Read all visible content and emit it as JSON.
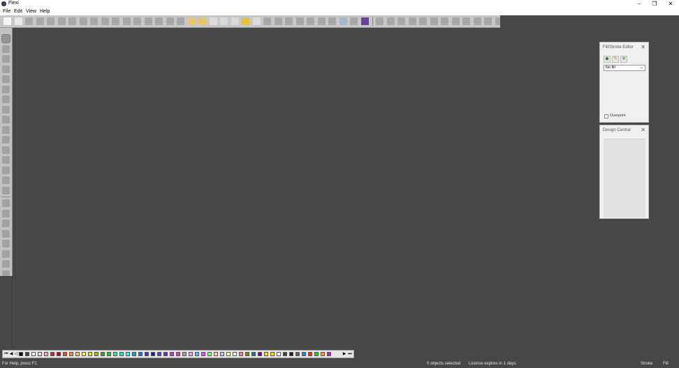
{
  "window": {
    "title": "Flexi",
    "controls": {
      "minimize": "–",
      "restore": "❐",
      "close": "✕"
    }
  },
  "menu": [
    {
      "label": "File"
    },
    {
      "label": "Edit"
    },
    {
      "label": "View"
    },
    {
      "label": "Help"
    }
  ],
  "toolbar": {
    "buttons": [
      {
        "icon": "new-icon",
        "color": "#f4f4f4"
      },
      {
        "icon": "open-icon",
        "color": "#e9e9e9"
      },
      {
        "icon": "save-icon",
        "color": "#a8a8a8"
      },
      {
        "icon": "save-as-icon",
        "color": "#a8a8a8"
      },
      {
        "icon": "print-icon",
        "color": "#a8a8a8"
      },
      {
        "icon": "import-icon",
        "color": "#a8a8a8"
      },
      {
        "icon": "export-icon",
        "color": "#a8a8a8"
      },
      {
        "icon": "send-icon",
        "color": "#a8a8a8"
      },
      {
        "icon": "cut-tool-icon",
        "color": "#a8a8a8"
      },
      {
        "icon": "rip-icon",
        "color": "#a8a8a8"
      },
      {
        "icon": "cut-icon",
        "color": "#a8a8a8"
      },
      {
        "icon": "copy-icon",
        "color": "#a8a8a8"
      },
      {
        "icon": "paste-icon",
        "color": "#a8a8a8"
      },
      {
        "icon": "undo-icon",
        "color": "#a8a8a8"
      },
      {
        "icon": "undo-more-icon",
        "color": "#a8a8a8"
      },
      {
        "icon": "redo-icon",
        "color": "#a8a8a8"
      },
      {
        "icon": "redo-more-icon",
        "color": "#a8a8a8"
      },
      {
        "icon": "job-icon",
        "color": "#e8c46a"
      },
      {
        "icon": "job-properties-icon",
        "color": "#e8c46a"
      },
      {
        "icon": "printer-setup-icon",
        "color": "#dcdcdc"
      },
      {
        "icon": "color-wheel-icon",
        "color": "#d9d9d9"
      },
      {
        "icon": "color-target-icon",
        "color": "#d9d9d9"
      },
      {
        "icon": "color-palette-icon",
        "color": "#e2c23a"
      },
      {
        "icon": "production-icon",
        "color": "#dcdcdc"
      },
      {
        "icon": "view-icon",
        "color": "#a8a8a8"
      },
      {
        "icon": "view-2-icon",
        "color": "#a8a8a8"
      },
      {
        "icon": "view-3-icon",
        "color": "#a8a8a8"
      },
      {
        "icon": "view-4-icon",
        "color": "#a8a8a8"
      },
      {
        "icon": "view-5-icon",
        "color": "#a8a8a8"
      },
      {
        "icon": "view-6-icon",
        "color": "#a8a8a8"
      },
      {
        "icon": "view-7-icon",
        "color": "#a8a8a8"
      },
      {
        "icon": "cloud-icon",
        "color": "#a0b8d0"
      },
      {
        "icon": "sign-icon",
        "color": "#a8a8a8"
      },
      {
        "icon": "app-logo-icon",
        "color": "#6a3fa0"
      },
      {
        "icon": "select-rect-icon",
        "color": "#a8a8a8"
      },
      {
        "icon": "lasso-icon",
        "color": "#a8a8a8"
      },
      {
        "icon": "line-tool-icon",
        "color": "#a8a8a8"
      },
      {
        "icon": "curve-icon",
        "color": "#a8a8a8"
      },
      {
        "icon": "knife-icon",
        "color": "#a8a8a8"
      },
      {
        "icon": "pen-icon",
        "color": "#a8a8a8"
      },
      {
        "icon": "pencil-icon",
        "color": "#a8a8a8"
      },
      {
        "icon": "brush-icon",
        "color": "#a8a8a8"
      },
      {
        "icon": "bucket-icon",
        "color": "#a8a8a8"
      },
      {
        "icon": "crop-icon",
        "color": "#a8a8a8"
      },
      {
        "icon": "stamp-icon",
        "color": "#a8a8a8"
      },
      {
        "icon": "eyedropper-icon",
        "color": "#a8a8a8"
      }
    ]
  },
  "left_tools": [
    {
      "icon": "select-arrow-icon"
    },
    {
      "icon": "text-tool-icon"
    },
    {
      "icon": "node-edit-icon"
    },
    {
      "icon": "shape-tool-icon"
    },
    {
      "icon": "warp-icon"
    },
    {
      "icon": "rectangle-tool-icon"
    },
    {
      "icon": "fill-tool-icon"
    },
    {
      "icon": "distort-icon"
    },
    {
      "icon": "contour-icon"
    },
    {
      "icon": "measure-icon"
    },
    {
      "icon": "pen-tool-icon"
    },
    {
      "icon": "knife-tool-icon"
    },
    {
      "icon": "eraser-icon"
    },
    {
      "icon": "zoom-tool-icon"
    },
    {
      "icon": "zoom-in-icon"
    },
    {
      "icon": "page-icon"
    },
    {
      "icon": "zoom-out-icon"
    },
    {
      "icon": "hand-icon"
    },
    {
      "icon": "zoom-fit-icon"
    },
    {
      "icon": "zoom-selection-icon"
    },
    {
      "icon": "zoom-previous-icon"
    },
    {
      "icon": "zoom-all-icon"
    },
    {
      "icon": "pan-icon"
    },
    {
      "icon": "color-picker-icon"
    }
  ],
  "fill_stroke_panel": {
    "title": "Fill/Stroke Editor",
    "close": "✕",
    "fill_select": "No fill",
    "fill_options": [
      "No fill"
    ],
    "overprint_label": "Overprint",
    "overprint_checked": false
  },
  "design_central_panel": {
    "title": "Design Central",
    "close": "✕"
  },
  "palette": {
    "nav_left": [
      "⏮",
      "◀",
      "◁"
    ],
    "nav_right": [
      "▶",
      "⏭"
    ],
    "swatches": [
      "#000000",
      "#444444",
      "#ffffff",
      "#dcdcdc",
      "#f7a4a4",
      "#d02020",
      "#b01010",
      "#f05020",
      "#f09030",
      "#f8c060",
      "#ffff40",
      "#d8e020",
      "#90c020",
      "#40a020",
      "#20c040",
      "#40e080",
      "#20e0c0",
      "#40f0f0",
      "#20a0d0",
      "#2070e0",
      "#2040c0",
      "#1020a0",
      "#6040c0",
      "#8020c0",
      "#c040c0",
      "#e040a0",
      "#a0a0a0",
      "#f0a0f0",
      "#40c0ff",
      "#ff40ff",
      "#80ff80",
      "#ffd0a0",
      "#c0c0ff",
      "#ffff80",
      "#ffffff",
      "#ff8080",
      "#808000",
      "#008080",
      "#800080",
      "#ffd700",
      "#ffd700",
      "#ffffff",
      "#404040",
      "#202020",
      "#606060",
      "#2080ff",
      "#ff2020",
      "#20d020",
      "#ffa020",
      "#c020c0"
    ]
  },
  "statusbar": {
    "help": "For Help, press F1",
    "selection": "0 objects selected",
    "license": "License expires in 1 days.",
    "stroke": "Stroke",
    "fill": "Fill"
  },
  "colors": {
    "workspace": "#474747",
    "toolbar": "#c7c7c7",
    "panel": "#f0f0f0"
  }
}
